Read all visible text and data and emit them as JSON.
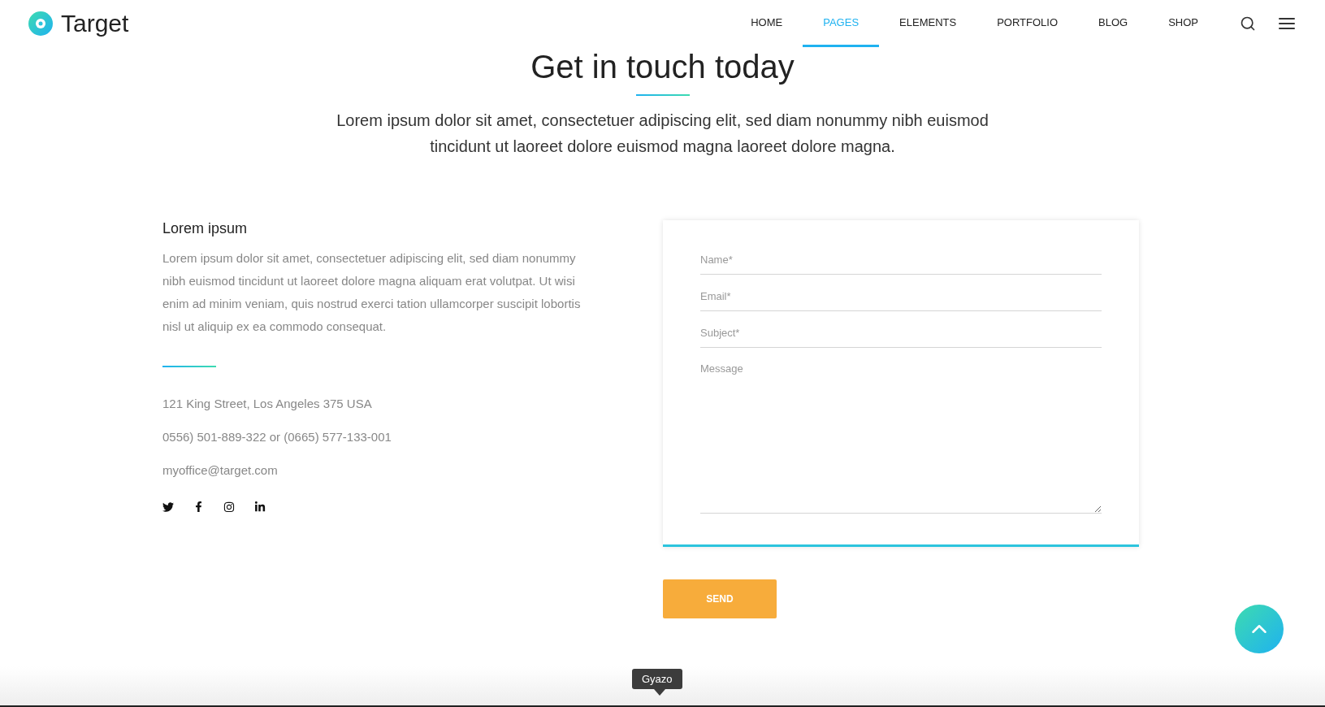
{
  "header": {
    "logo": "Target",
    "nav": [
      {
        "label": "HOME",
        "selected": false
      },
      {
        "label": "PAGES",
        "selected": true
      },
      {
        "label": "ELEMENTS",
        "selected": false
      },
      {
        "label": "PORTFOLIO",
        "selected": false
      },
      {
        "label": "BLOG",
        "selected": false
      },
      {
        "label": "SHOP",
        "selected": false
      }
    ]
  },
  "intro": {
    "title": "Get in touch today",
    "text": "Lorem ipsum dolor sit amet, consectetuer adipiscing elit, sed diam nonummy nibh euismod tincidunt ut laoreet dolore euismod magna laoreet dolore magna."
  },
  "info": {
    "heading": "Lorem ipsum",
    "text": "Lorem ipsum dolor sit amet, consectetuer adipiscing elit, sed diam nonummy nibh euismod tincidunt ut laoreet dolore magna aliquam erat volutpat. Ut wisi enim ad minim veniam, quis nostrud exerci tation ullamcorper suscipit lobortis nisl ut aliquip ex ea commodo consequat.",
    "address": "121 King Street, Los Angeles 375 USA",
    "phone": "0556) 501-889-322 or (0665) 577-133-001",
    "email": "myoffice@target.com",
    "social": [
      {
        "kind": "twitter"
      },
      {
        "kind": "facebook"
      },
      {
        "kind": "instagram"
      },
      {
        "kind": "linkedin"
      }
    ]
  },
  "form": {
    "fields": [
      {
        "kind": "input",
        "placeholder": "Name*"
      },
      {
        "kind": "input",
        "placeholder": "Email*"
      },
      {
        "kind": "input",
        "placeholder": "Subject*"
      },
      {
        "kind": "textarea",
        "placeholder": "Message"
      }
    ],
    "submit": "SEND"
  },
  "tooltip": "Gyazo"
}
